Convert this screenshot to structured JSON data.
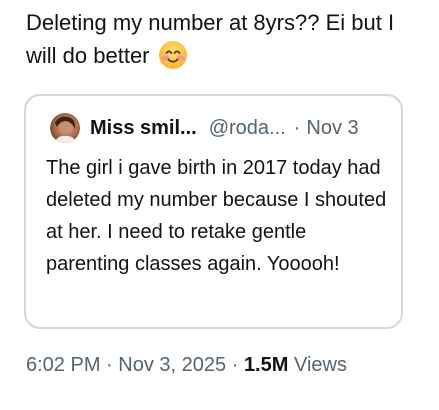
{
  "tweet": {
    "text": "Deleting my number at 8yrs?? Ei but I will do better",
    "emoji": "smiling-face-with-smiling-eyes"
  },
  "quote": {
    "author_name": "Miss smil...",
    "author_handle": "@roda...",
    "separator": "·",
    "date": "Nov 3",
    "text": "The girl i gave birth in 2017 today had deleted my number because I shouted at her. I need to retake gentle parenting classes again. Yooooh!"
  },
  "meta": {
    "time": "6:02 PM",
    "separator": "·",
    "date": "Nov 3, 2025",
    "views_count": "1.5M",
    "views_label": "Views"
  }
}
